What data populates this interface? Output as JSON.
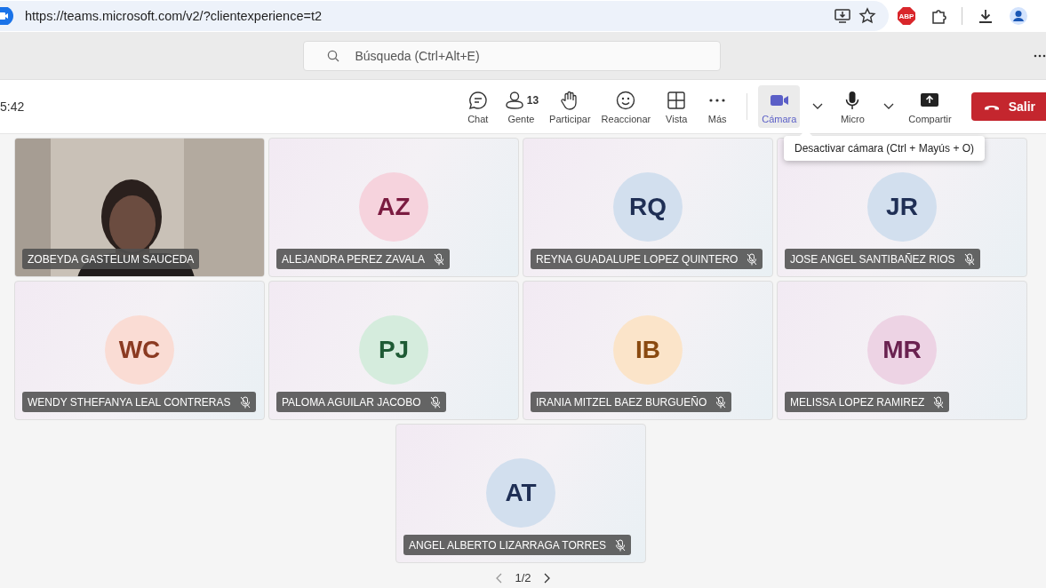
{
  "browser": {
    "url": "https://teams.microsoft.com/v2/?clientexperience=t2",
    "extension_badge": "ABP"
  },
  "header": {
    "search": {
      "placeholder": "Búsqueda (Ctrl+Alt+E)"
    }
  },
  "toolbar": {
    "timer": "5:42",
    "items": [
      {
        "kind": "chat",
        "label": "Chat",
        "selected": false
      },
      {
        "kind": "people",
        "label": "Gente",
        "count": "13",
        "selected": false
      },
      {
        "kind": "hand",
        "label": "Participar",
        "selected": false
      },
      {
        "kind": "react",
        "label": "Reaccionar",
        "selected": false
      },
      {
        "kind": "view",
        "label": "Vista",
        "selected": false
      },
      {
        "kind": "more",
        "label": "Más",
        "selected": false
      },
      {
        "kind": "camera",
        "label": "Cámara",
        "selected": true,
        "dropdown": true
      },
      {
        "kind": "mic",
        "label": "Micro",
        "selected": false,
        "dropdown": true
      },
      {
        "kind": "share",
        "label": "Compartir",
        "selected": false
      }
    ],
    "leave": "Salir"
  },
  "tooltip": "Desactivar cámara (Ctrl + Mayús + O)",
  "participants": [
    {
      "kind": "video",
      "name": "ZOBEYDA GASTELUM SAUCEDA",
      "muted": false
    },
    {
      "kind": "avatar",
      "initials": "AZ",
      "name": "ALEJANDRA PEREZ ZAVALA",
      "muted": true,
      "color": "#f6d3dd"
    },
    {
      "kind": "avatar",
      "initials": "RQ",
      "name": "REYNA GUADALUPE LOPEZ QUINTERO",
      "muted": true,
      "color": "#d2dfee"
    },
    {
      "kind": "avatar",
      "initials": "JR",
      "name": "JOSE ANGEL SANTIBAÑEZ RIOS",
      "muted": true,
      "color": "#d2dfee"
    },
    {
      "kind": "avatar",
      "initials": "WC",
      "name": "WENDY STHEFANYA LEAL CONTRERAS",
      "muted": true,
      "color": "#fadcd4"
    },
    {
      "kind": "avatar",
      "initials": "PJ",
      "name": "PALOMA AGUILAR JACOBO",
      "muted": true,
      "color": "#d5ecdd"
    },
    {
      "kind": "avatar",
      "initials": "IB",
      "name": "IRANIA MITZEL BAEZ BURGUEÑO",
      "muted": true,
      "color": "#fbe4c9"
    },
    {
      "kind": "avatar",
      "initials": "MR",
      "name": "MELISSA LOPEZ RAMIREZ",
      "muted": true,
      "color": "#edd3e4"
    },
    {
      "kind": "avatar",
      "initials": "AT",
      "name": "ANGEL ALBERTO LIZARRAGA TORRES",
      "muted": true,
      "color": "#d2dfee"
    }
  ],
  "pager": {
    "label": "1/2"
  }
}
